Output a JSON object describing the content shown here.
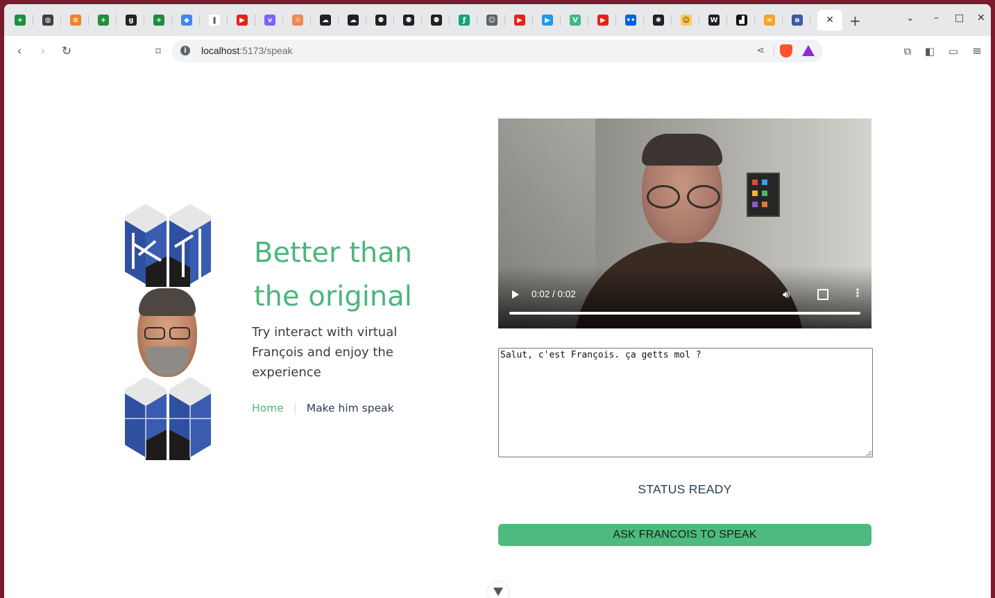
{
  "browser": {
    "tabs": [
      {
        "icon": "sheets-icon",
        "color": "#1e8e3e",
        "glyph": "+"
      },
      {
        "icon": "globe-icon",
        "color": "#3c4043",
        "glyph": "◍"
      },
      {
        "icon": "stackoverflow-icon",
        "color": "#f48024",
        "glyph": "≡"
      },
      {
        "icon": "sheets-icon",
        "color": "#1e8e3e",
        "glyph": "+"
      },
      {
        "icon": "g-icon",
        "color": "#202124",
        "glyph": "g"
      },
      {
        "icon": "sheets-icon",
        "color": "#1e8e3e",
        "glyph": "+"
      },
      {
        "icon": "diamond-icon",
        "color": "#4285f4",
        "glyph": "◆"
      },
      {
        "icon": "pause-icon",
        "color": "#ffffff",
        "glyph": "‖"
      },
      {
        "icon": "youtube-icon",
        "color": "#e62117",
        "glyph": "▶"
      },
      {
        "icon": "v-icon",
        "color": "#7b61ff",
        "glyph": "v"
      },
      {
        "icon": "brain-icon",
        "color": "#f08a4b",
        "glyph": "☼"
      },
      {
        "icon": "cloud-icon",
        "color": "#202124",
        "glyph": "☁"
      },
      {
        "icon": "cloud-icon",
        "color": "#202124",
        "glyph": "☁"
      },
      {
        "icon": "robot-icon",
        "color": "#202124",
        "glyph": "⚉"
      },
      {
        "icon": "robot-icon",
        "color": "#202124",
        "glyph": "⚉"
      },
      {
        "icon": "robot-icon",
        "color": "#202124",
        "glyph": "⚉"
      },
      {
        "icon": "leaf-icon",
        "color": "#11a37f",
        "glyph": "ƒ"
      },
      {
        "icon": "user-icon",
        "color": "#5f6368",
        "glyph": "☺"
      },
      {
        "icon": "youtube-icon",
        "color": "#e62117",
        "glyph": "▶"
      },
      {
        "icon": "play-circle-icon",
        "color": "#1a9bf0",
        "glyph": "▶"
      },
      {
        "icon": "vue-icon",
        "color": "#41b883",
        "glyph": "V"
      },
      {
        "icon": "youtube-icon",
        "color": "#e62117",
        "glyph": "▶"
      },
      {
        "icon": "flickr-icon",
        "color": "#0063dc",
        "glyph": "••"
      },
      {
        "icon": "openai-icon",
        "color": "#202124",
        "glyph": "✺"
      },
      {
        "icon": "huggingface-icon",
        "color": "#ffcc4d",
        "glyph": "☺"
      },
      {
        "icon": "wikipedia-icon",
        "color": "#202124",
        "glyph": "W"
      },
      {
        "icon": "unsplash-icon",
        "color": "#111111",
        "glyph": "▟"
      },
      {
        "icon": "infinity-icon",
        "color": "#f5a623",
        "glyph": "∞"
      },
      {
        "icon": "butterfly-icon",
        "color": "#3b5aa8",
        "glyph": "ʚ"
      }
    ],
    "active_tab_close": "✕",
    "new_tab": "+",
    "window_controls": {
      "chevron": "⌄",
      "minimize": "–",
      "maximize": "□",
      "close": "✕"
    },
    "url_host": "localhost",
    "url_path": ":5173/speak"
  },
  "hero": {
    "headline": "Better than the original",
    "subtitle": "Try interact with virtual François and enjoy the experience"
  },
  "nav": {
    "home": "Home",
    "speak": "Make him speak"
  },
  "video": {
    "time": "0:02 / 0:02",
    "progress": 1.0
  },
  "speech": {
    "text": "Salut, c'est François. ça getts mol ?"
  },
  "status": "STATUS READY",
  "ask_button": "ASK FRANCOIS TO SPEAK",
  "colors": {
    "accent": "#4cb67a",
    "button": "#4cbb7d",
    "logo_blue": "#2f4fa0",
    "text_dark": "#2c3e50"
  }
}
